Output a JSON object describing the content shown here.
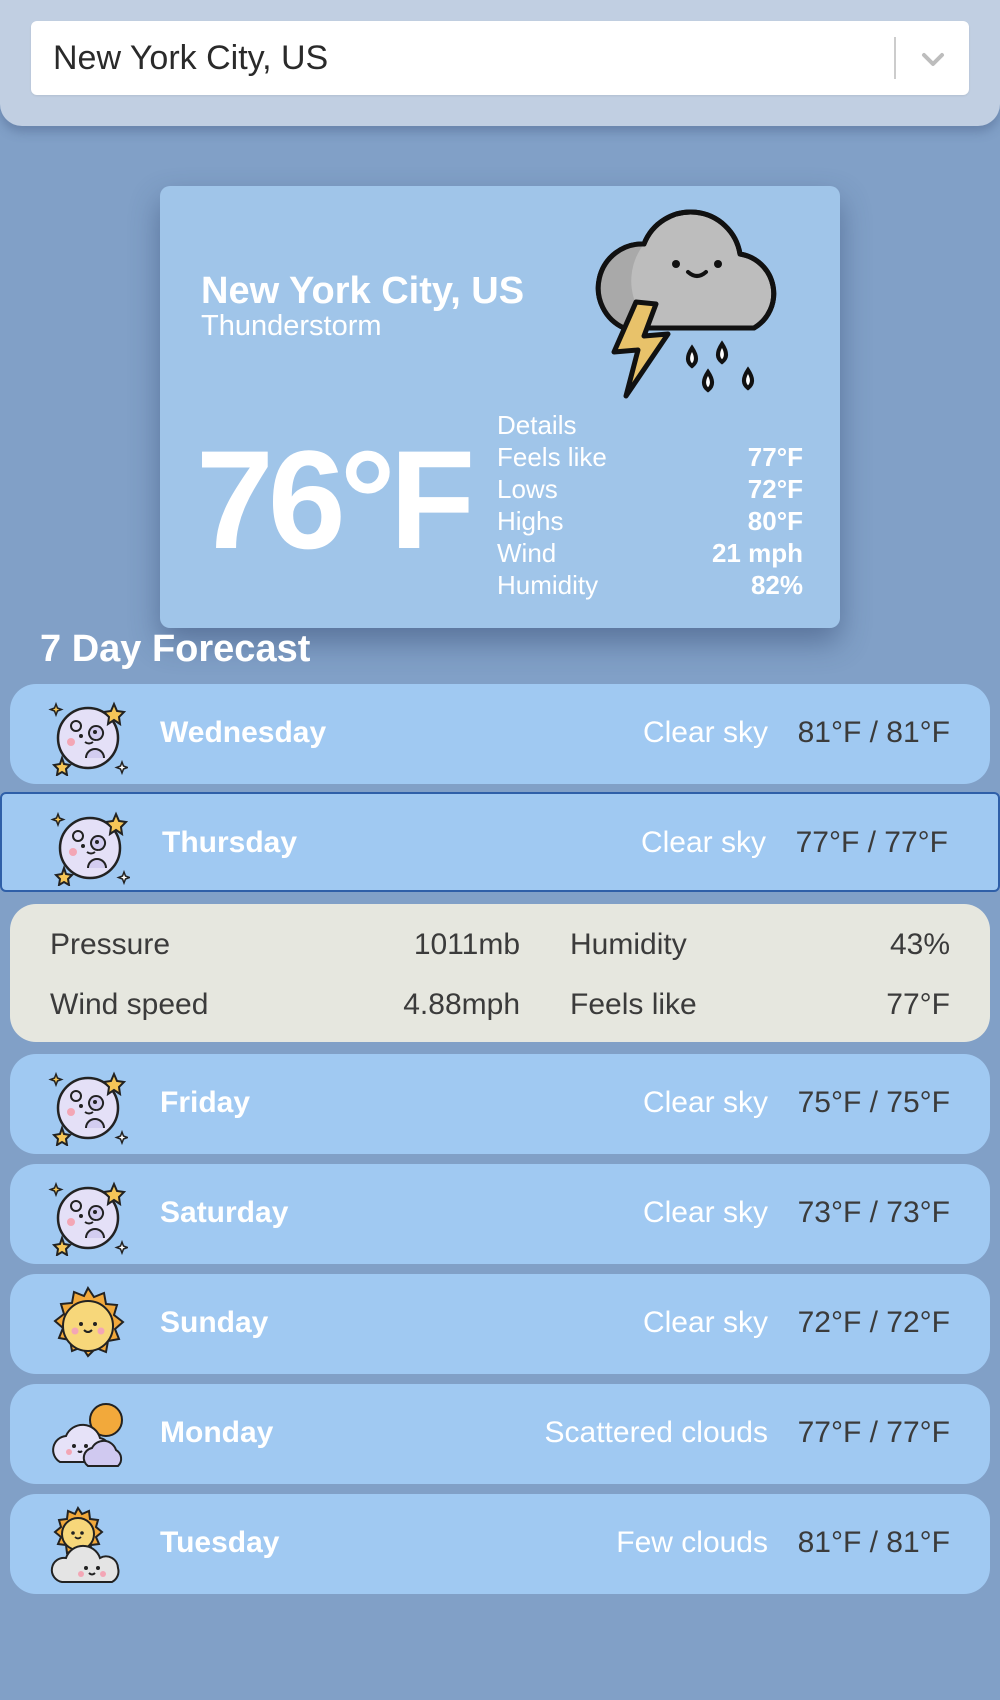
{
  "search": {
    "selected_value": "New York City, US",
    "chevron_icon": "chevron-down-icon"
  },
  "current": {
    "city": "New York City, US",
    "description": "Thunderstorm",
    "temperature": "76°F",
    "icon": "thunderstorm-cloud-icon",
    "details_title": "Details",
    "details": [
      {
        "label": "Feels like",
        "value": "77°F"
      },
      {
        "label": "Lows",
        "value": "72°F"
      },
      {
        "label": "Highs",
        "value": "80°F"
      },
      {
        "label": "Wind",
        "value": "21 mph"
      },
      {
        "label": "Humidity",
        "value": "82%"
      }
    ]
  },
  "forecast": {
    "title": "7 Day Forecast",
    "days": [
      {
        "day": "Wednesday",
        "description": "Clear sky",
        "temps": "81°F / 81°F",
        "icon": "moon-stars-icon"
      },
      {
        "day": "Thursday",
        "description": "Clear sky",
        "temps": "77°F / 77°F",
        "icon": "moon-stars-icon"
      },
      {
        "day": "Friday",
        "description": "Clear sky",
        "temps": "75°F / 75°F",
        "icon": "moon-stars-icon"
      },
      {
        "day": "Saturday",
        "description": "Clear sky",
        "temps": "73°F / 73°F",
        "icon": "moon-stars-icon"
      },
      {
        "day": "Sunday",
        "description": "Clear sky",
        "temps": "72°F / 72°F",
        "icon": "sun-icon"
      },
      {
        "day": "Monday",
        "description": "Scattered clouds",
        "temps": "77°F / 77°F",
        "icon": "scattered-clouds-icon"
      },
      {
        "day": "Tuesday",
        "description": "Few clouds",
        "temps": "81°F / 81°F",
        "icon": "sun-behind-cloud-icon"
      }
    ],
    "expanded": {
      "pressure_label": "Pressure",
      "pressure_value": "1011mb",
      "humidity_label": "Humidity",
      "humidity_value": "43%",
      "wind_label": "Wind speed",
      "wind_value": "4.88mph",
      "feels_label": "Feels like",
      "feels_value": "77°F"
    }
  },
  "colors": {
    "background": "#81a0c7",
    "card": "#a0c5e9",
    "row": "#a0c9f2",
    "expanded": "#e6e7df",
    "selected_border": "#2f5fa8"
  }
}
